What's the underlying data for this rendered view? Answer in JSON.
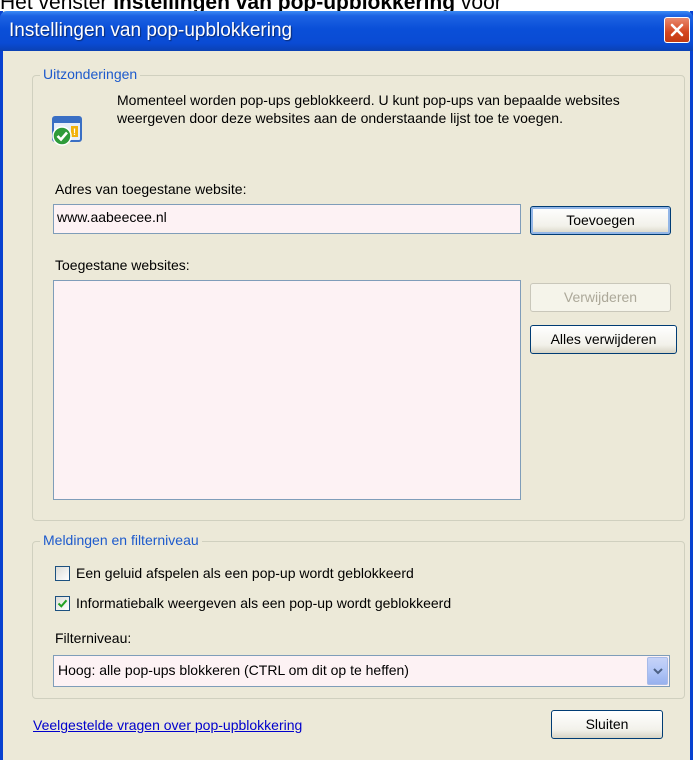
{
  "caption": {
    "prefix": "Het venster ",
    "bold": "Instellingen van pop-upblokkering",
    "suffix": " voor"
  },
  "window": {
    "title": "Instellingen van pop-upblokkering"
  },
  "exceptions": {
    "legend": "Uitzonderingen",
    "info_text": "Momenteel worden pop-ups geblokkeerd. U kunt pop-ups van bepaalde websites weergeven door deze websites aan de onderstaande lijst toe te voegen.",
    "address_label": "Adres van toegestane website:",
    "address_value": "www.aabeecee.nl",
    "add_button": "Toevoegen",
    "allowed_label": "Toegestane websites:",
    "allowed_sites": [],
    "remove_button": "Verwijderen",
    "remove_all_button": "Alles verwijderen"
  },
  "notifications": {
    "legend": "Meldingen en filterniveau",
    "sound_label": "Een geluid afspelen als een pop-up wordt geblokkeerd",
    "sound_checked": false,
    "infobar_label": "Informatiebalk weergeven als een pop-up wordt geblokkeerd",
    "infobar_checked": true,
    "filter_label": "Filterniveau:",
    "filter_value": "Hoog: alle pop-ups blokkeren (CTRL om dit op te heffen)"
  },
  "footer": {
    "help_link": "Veelgestelde vragen over pop-upblokkering",
    "close_button": "Sluiten"
  }
}
